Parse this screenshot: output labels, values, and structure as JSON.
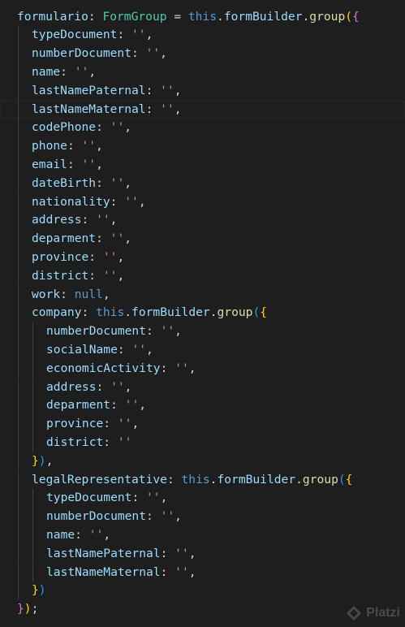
{
  "colors": {
    "background": "#1e1e1e",
    "property": "#9cdcfe",
    "type": "#4ec9b0",
    "function": "#dcdcaa",
    "keyword": "#569cd6",
    "string": "#ce9178",
    "punctuation": "#d4d4d4",
    "bracket_level_1": "#ffd700",
    "bracket_level_2": "#da70d6",
    "bracket_level_3": "#179fff"
  },
  "current_line": 5,
  "lines": [
    {
      "indent": 0,
      "tokens": [
        [
          "var",
          "formulario"
        ],
        [
          "pun",
          ": "
        ],
        [
          "type",
          "FormGroup"
        ],
        [
          "pun",
          " = "
        ],
        [
          "kw",
          "this"
        ],
        [
          "pun",
          "."
        ],
        [
          "prop",
          "formBuilder"
        ],
        [
          "pun",
          "."
        ],
        [
          "fn",
          "group"
        ],
        [
          "b1",
          "("
        ],
        [
          "b2",
          "{"
        ]
      ]
    },
    {
      "indent": 1,
      "tokens": [
        [
          "prop",
          "typeDocument"
        ],
        [
          "pun",
          ": "
        ],
        [
          "str",
          "''"
        ],
        [
          "pun",
          ","
        ]
      ]
    },
    {
      "indent": 1,
      "tokens": [
        [
          "prop",
          "numberDocument"
        ],
        [
          "pun",
          ": "
        ],
        [
          "str",
          "''"
        ],
        [
          "pun",
          ","
        ]
      ]
    },
    {
      "indent": 1,
      "tokens": [
        [
          "prop",
          "name"
        ],
        [
          "pun",
          ": "
        ],
        [
          "str",
          "''"
        ],
        [
          "pun",
          ","
        ]
      ]
    },
    {
      "indent": 1,
      "tokens": [
        [
          "prop",
          "lastNamePaternal"
        ],
        [
          "pun",
          ": "
        ],
        [
          "str",
          "''"
        ],
        [
          "pun",
          ","
        ]
      ]
    },
    {
      "indent": 1,
      "tokens": [
        [
          "prop",
          "lastNameMaternal"
        ],
        [
          "pun",
          ": "
        ],
        [
          "str",
          "''"
        ],
        [
          "pun",
          ","
        ]
      ]
    },
    {
      "indent": 1,
      "tokens": [
        [
          "prop",
          "codePhone"
        ],
        [
          "pun",
          ": "
        ],
        [
          "str",
          "''"
        ],
        [
          "pun",
          ","
        ]
      ]
    },
    {
      "indent": 1,
      "tokens": [
        [
          "prop",
          "phone"
        ],
        [
          "pun",
          ": "
        ],
        [
          "str",
          "''"
        ],
        [
          "pun",
          ","
        ]
      ]
    },
    {
      "indent": 1,
      "tokens": [
        [
          "prop",
          "email"
        ],
        [
          "pun",
          ": "
        ],
        [
          "str",
          "''"
        ],
        [
          "pun",
          ","
        ]
      ]
    },
    {
      "indent": 1,
      "tokens": [
        [
          "prop",
          "dateBirth"
        ],
        [
          "pun",
          ": "
        ],
        [
          "str",
          "''"
        ],
        [
          "pun",
          ","
        ]
      ]
    },
    {
      "indent": 1,
      "tokens": [
        [
          "prop",
          "nationality"
        ],
        [
          "pun",
          ": "
        ],
        [
          "str",
          "''"
        ],
        [
          "pun",
          ","
        ]
      ]
    },
    {
      "indent": 1,
      "tokens": [
        [
          "prop",
          "address"
        ],
        [
          "pun",
          ": "
        ],
        [
          "str",
          "''"
        ],
        [
          "pun",
          ","
        ]
      ]
    },
    {
      "indent": 1,
      "tokens": [
        [
          "prop",
          "deparment"
        ],
        [
          "pun",
          ": "
        ],
        [
          "str",
          "''"
        ],
        [
          "pun",
          ","
        ]
      ]
    },
    {
      "indent": 1,
      "tokens": [
        [
          "prop",
          "province"
        ],
        [
          "pun",
          ": "
        ],
        [
          "str",
          "''"
        ],
        [
          "pun",
          ","
        ]
      ]
    },
    {
      "indent": 1,
      "tokens": [
        [
          "prop",
          "district"
        ],
        [
          "pun",
          ": "
        ],
        [
          "str",
          "''"
        ],
        [
          "pun",
          ","
        ]
      ]
    },
    {
      "indent": 1,
      "tokens": [
        [
          "prop",
          "work"
        ],
        [
          "pun",
          ": "
        ],
        [
          "kw",
          "null"
        ],
        [
          "pun",
          ","
        ]
      ]
    },
    {
      "indent": 1,
      "tokens": [
        [
          "prop",
          "company"
        ],
        [
          "pun",
          ": "
        ],
        [
          "kw",
          "this"
        ],
        [
          "pun",
          "."
        ],
        [
          "prop",
          "formBuilder"
        ],
        [
          "pun",
          "."
        ],
        [
          "fn",
          "group"
        ],
        [
          "b3",
          "("
        ],
        [
          "b1",
          "{"
        ]
      ]
    },
    {
      "indent": 2,
      "tokens": [
        [
          "prop",
          "numberDocument"
        ],
        [
          "pun",
          ": "
        ],
        [
          "str",
          "''"
        ],
        [
          "pun",
          ","
        ]
      ]
    },
    {
      "indent": 2,
      "tokens": [
        [
          "prop",
          "socialName"
        ],
        [
          "pun",
          ": "
        ],
        [
          "str",
          "''"
        ],
        [
          "pun",
          ","
        ]
      ]
    },
    {
      "indent": 2,
      "tokens": [
        [
          "prop",
          "economicActivity"
        ],
        [
          "pun",
          ": "
        ],
        [
          "str",
          "''"
        ],
        [
          "pun",
          ","
        ]
      ]
    },
    {
      "indent": 2,
      "tokens": [
        [
          "prop",
          "address"
        ],
        [
          "pun",
          ": "
        ],
        [
          "str",
          "''"
        ],
        [
          "pun",
          ","
        ]
      ]
    },
    {
      "indent": 2,
      "tokens": [
        [
          "prop",
          "deparment"
        ],
        [
          "pun",
          ": "
        ],
        [
          "str",
          "''"
        ],
        [
          "pun",
          ","
        ]
      ]
    },
    {
      "indent": 2,
      "tokens": [
        [
          "prop",
          "province"
        ],
        [
          "pun",
          ": "
        ],
        [
          "str",
          "''"
        ],
        [
          "pun",
          ","
        ]
      ]
    },
    {
      "indent": 2,
      "tokens": [
        [
          "prop",
          "district"
        ],
        [
          "pun",
          ": "
        ],
        [
          "str",
          "''"
        ]
      ]
    },
    {
      "indent": 1,
      "tokens": [
        [
          "b1",
          "}"
        ],
        [
          "b3",
          ")"
        ],
        [
          "pun",
          ","
        ]
      ]
    },
    {
      "indent": 1,
      "tokens": [
        [
          "prop",
          "legalRepresentative"
        ],
        [
          "pun",
          ": "
        ],
        [
          "kw",
          "this"
        ],
        [
          "pun",
          "."
        ],
        [
          "prop",
          "formBuilder"
        ],
        [
          "pun",
          "."
        ],
        [
          "fn",
          "group"
        ],
        [
          "b3",
          "("
        ],
        [
          "b1",
          "{"
        ]
      ]
    },
    {
      "indent": 2,
      "tokens": [
        [
          "prop",
          "typeDocument"
        ],
        [
          "pun",
          ": "
        ],
        [
          "str",
          "''"
        ],
        [
          "pun",
          ","
        ]
      ]
    },
    {
      "indent": 2,
      "tokens": [
        [
          "prop",
          "numberDocument"
        ],
        [
          "pun",
          ": "
        ],
        [
          "str",
          "''"
        ],
        [
          "pun",
          ","
        ]
      ]
    },
    {
      "indent": 2,
      "tokens": [
        [
          "prop",
          "name"
        ],
        [
          "pun",
          ": "
        ],
        [
          "str",
          "''"
        ],
        [
          "pun",
          ","
        ]
      ]
    },
    {
      "indent": 2,
      "tokens": [
        [
          "prop",
          "lastNamePaternal"
        ],
        [
          "pun",
          ": "
        ],
        [
          "str",
          "''"
        ],
        [
          "pun",
          ","
        ]
      ]
    },
    {
      "indent": 2,
      "tokens": [
        [
          "prop",
          "lastNameMaternal"
        ],
        [
          "pun",
          ": "
        ],
        [
          "str",
          "''"
        ],
        [
          "pun",
          ","
        ]
      ]
    },
    {
      "indent": 1,
      "tokens": [
        [
          "b1",
          "}"
        ],
        [
          "b3",
          ")"
        ]
      ]
    },
    {
      "indent": 0,
      "tokens": [
        [
          "b2",
          "}"
        ],
        [
          "b1",
          ")"
        ],
        [
          "pun",
          ";"
        ]
      ]
    }
  ],
  "watermark": {
    "text": "Platzi",
    "icon": "platzi-logo-icon"
  }
}
